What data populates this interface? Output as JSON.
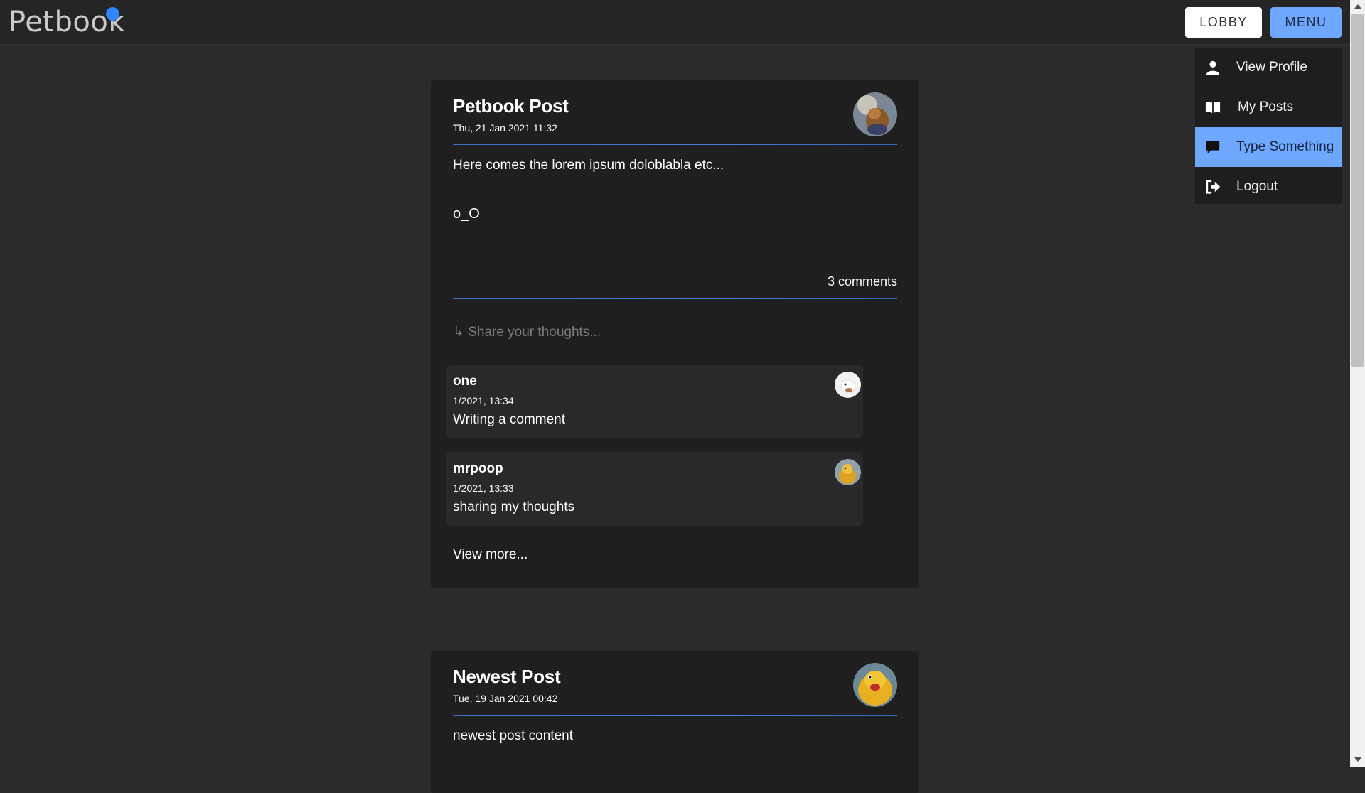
{
  "header": {
    "logo_text": "Petbook",
    "lobby_label": "LOBBY",
    "menu_label": "MENU"
  },
  "menu": {
    "items": [
      {
        "label": "View Profile",
        "icon": "user-icon"
      },
      {
        "label": "My Posts",
        "icon": "book-icon"
      },
      {
        "label": "Type Something",
        "icon": "comment-icon",
        "active": true
      },
      {
        "label": "Logout",
        "icon": "logout-icon"
      }
    ]
  },
  "posts": [
    {
      "title": "Petbook Post",
      "date": "Thu, 21 Jan 2021 11:32",
      "body_lines": [
        "Here comes the lorem ipsum doloblabla etc...",
        "o_O"
      ],
      "comment_count": "3 comments",
      "share_placeholder": "↳ Share your thoughts...",
      "comments": [
        {
          "user": "one",
          "date": "1/2021, 13:34",
          "text": "Writing a comment"
        },
        {
          "user": "mrpoop",
          "date": "1/2021, 13:33",
          "text": "sharing my thoughts"
        }
      ],
      "view_more": "View more..."
    },
    {
      "title": "Newest Post",
      "date": "Tue, 19 Jan 2021 00:42",
      "body_lines": [
        "newest post content"
      ]
    }
  ],
  "colors": {
    "accent": "#6ea8fe",
    "logo_dot": "#2f86ff",
    "background": "#2b2b2b",
    "card": "#1f1f1f"
  }
}
